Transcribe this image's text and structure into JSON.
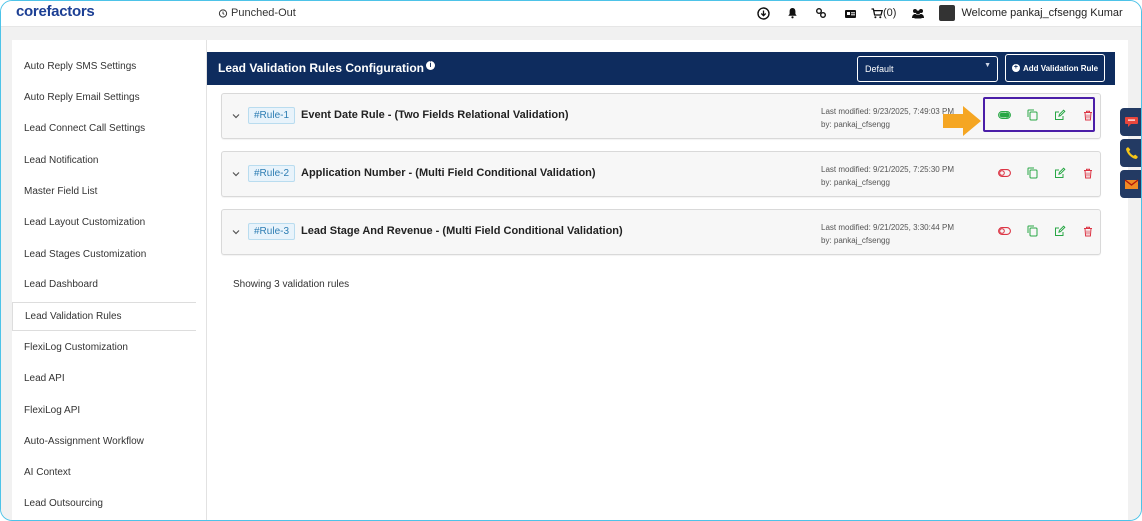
{
  "app": {
    "logo": "corefactors",
    "punch_status": "Punched-Out",
    "cart_label": "(0)",
    "welcome": "Welcome pankaj_cfsengg Kumar"
  },
  "sidebar": {
    "items": [
      {
        "label": "Auto Reply SMS Settings"
      },
      {
        "label": "Auto Reply Email Settings"
      },
      {
        "label": "Lead Connect Call Settings"
      },
      {
        "label": "Lead Notification"
      },
      {
        "label": "Master Field List"
      },
      {
        "label": "Lead Layout Customization"
      },
      {
        "label": "Lead Stages Customization"
      },
      {
        "label": "Lead Dashboard"
      },
      {
        "label": "Lead Validation Rules",
        "active": true
      },
      {
        "label": "FlexiLog Customization"
      },
      {
        "label": "Lead API"
      },
      {
        "label": "FlexiLog API"
      },
      {
        "label": "Auto-Assignment Workflow"
      },
      {
        "label": "AI Context"
      },
      {
        "label": "Lead Outsourcing"
      }
    ]
  },
  "header": {
    "title": "Lead Validation Rules Configuration",
    "select_value": "Default",
    "add_button": "Add Validation Rule"
  },
  "rules": [
    {
      "tag": "#Rule-1",
      "name": "Event Date Rule - (Two Fields Relational Validation)",
      "modified": "Last modified: 9/23/2025, 7:49:03 PM",
      "by": "by: pankaj_cfsengg",
      "enabled": true
    },
    {
      "tag": "#Rule-2",
      "name": "Application Number - (Multi Field Conditional Validation)",
      "modified": "Last modified: 9/21/2025, 7:25:30 PM",
      "by": "by: pankaj_cfsengg",
      "enabled": false
    },
    {
      "tag": "#Rule-3",
      "name": "Lead Stage And Revenue - (Multi Field Conditional Validation)",
      "modified": "Last modified: 9/21/2025, 3:30:44 PM",
      "by": "by: pankaj_cfsengg",
      "enabled": false
    }
  ],
  "footer": {
    "showing": "Showing 3 validation rules"
  },
  "colors": {
    "header_bg": "#0e2c5e",
    "toggle_on": "#28a745",
    "toggle_off": "#dc3545",
    "copy": "#28a745",
    "edit": "#28a745",
    "delete": "#dc3545",
    "highlight": "#4b1ea8",
    "arrow": "#f5a623",
    "frame": "#4dc3e8"
  },
  "icons": [
    "alarm-clock-icon",
    "download-icon",
    "bell-icon",
    "link-icon",
    "id-card-icon",
    "cart-icon",
    "users-icon",
    "avatar",
    "info-icon",
    "plus-circle-icon",
    "chevron-down-icon",
    "toggle-icon",
    "copy-icon",
    "edit-icon",
    "trash-icon",
    "arrow-right-icon",
    "chat-icon",
    "phone-icon",
    "email-icon"
  ]
}
